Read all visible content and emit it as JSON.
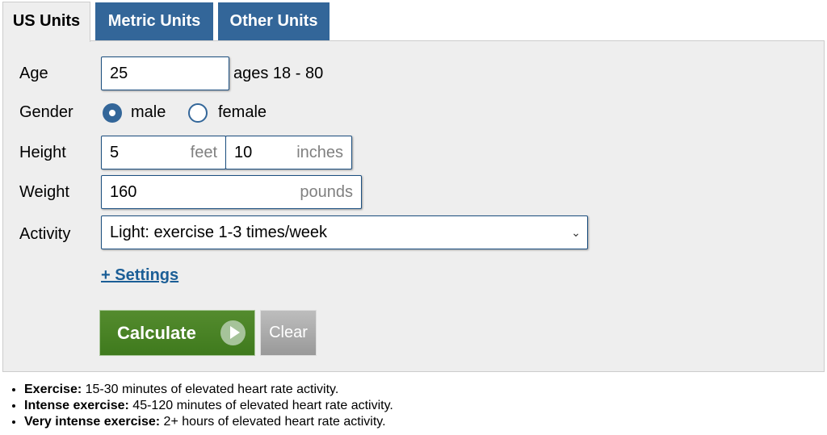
{
  "tabs": [
    {
      "label": "US Units",
      "active": true
    },
    {
      "label": "Metric Units",
      "active": false
    },
    {
      "label": "Other Units",
      "active": false
    }
  ],
  "form": {
    "age": {
      "label": "Age",
      "value": "25",
      "hint": "ages 18 - 80"
    },
    "gender": {
      "label": "Gender",
      "options": [
        "male",
        "female"
      ],
      "selected": "male"
    },
    "height": {
      "label": "Height",
      "feet_value": "5",
      "feet_unit": "feet",
      "inches_value": "10",
      "inches_unit": "inches"
    },
    "weight": {
      "label": "Weight",
      "value": "160",
      "unit": "pounds"
    },
    "activity": {
      "label": "Activity",
      "selected": "Light: exercise 1-3 times/week"
    },
    "settings_link": "+ Settings",
    "calculate_label": "Calculate",
    "clear_label": "Clear"
  },
  "notes": [
    {
      "term": "Exercise:",
      "text": " 15-30 minutes of elevated heart rate activity."
    },
    {
      "term": "Intense exercise:",
      "text": " 45-120 minutes of elevated heart rate activity."
    },
    {
      "term": "Very intense exercise:",
      "text": " 2+ hours of elevated heart rate activity."
    }
  ],
  "colors": {
    "tab_blue": "#336699",
    "calc_green": "#4a8226",
    "link_blue": "#1b5e96"
  }
}
